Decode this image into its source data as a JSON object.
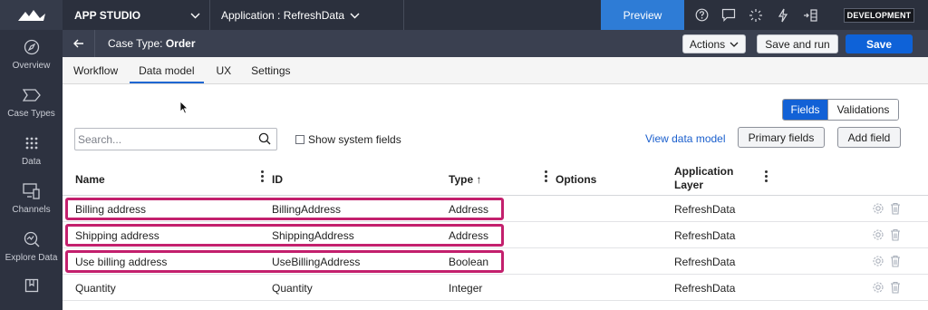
{
  "sidebar": {
    "items": [
      {
        "label": "Overview",
        "icon": "compass-icon"
      },
      {
        "label": "Case Types",
        "icon": "case-types-icon"
      },
      {
        "label": "Data",
        "icon": "grid-dots-icon"
      },
      {
        "label": "Channels",
        "icon": "channels-icon"
      },
      {
        "label": "Explore Data",
        "icon": "explore-data-icon"
      },
      {
        "label": "",
        "icon": "book-icon"
      }
    ]
  },
  "topbar": {
    "app_studio": "APP STUDIO",
    "application": "Application : RefreshData",
    "preview": "Preview",
    "environment": "DEVELOPMENT"
  },
  "header": {
    "case_type_prefix": "Case Type:",
    "case_type_name": "Order",
    "actions": "Actions",
    "save_and_run": "Save and run",
    "save": "Save"
  },
  "tabs": [
    "Workflow",
    "Data model",
    "UX",
    "Settings"
  ],
  "active_tab": "Data model",
  "toolbar": {
    "fields": "Fields",
    "validations": "Validations",
    "search_placeholder": "Search...",
    "show_system_fields": "Show system fields",
    "view_data_model": "View data model",
    "primary_fields": "Primary fields",
    "add_field": "Add field"
  },
  "table": {
    "headers": {
      "name": "Name",
      "id": "ID",
      "type": "Type ↑",
      "options": "Options",
      "app_layer_1": "Application",
      "app_layer_2": "Layer"
    },
    "rows": [
      {
        "name": "Billing address",
        "id": "BillingAddress",
        "type": "Address",
        "layer": "RefreshData"
      },
      {
        "name": "Shipping address",
        "id": "ShippingAddress",
        "type": "Address",
        "layer": "RefreshData"
      },
      {
        "name": "Use billing address",
        "id": "UseBillingAddress",
        "type": "Boolean",
        "layer": "RefreshData"
      },
      {
        "name": "Quantity",
        "id": "Quantity",
        "type": "Integer",
        "layer": "RefreshData"
      }
    ]
  },
  "colors": {
    "accent": "#0e62d8",
    "highlight": "#c3206d",
    "sidebar": "#2d3240"
  }
}
